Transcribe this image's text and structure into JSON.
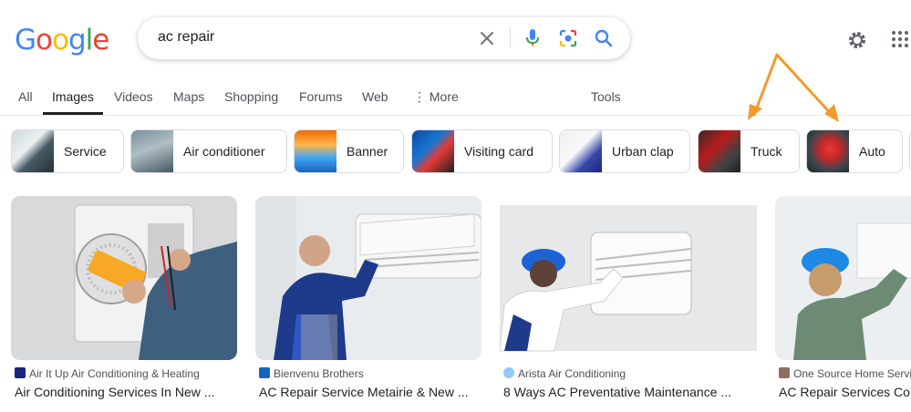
{
  "header": {
    "logo_text": "Google",
    "search": {
      "query": "ac repair"
    }
  },
  "tabs": [
    {
      "label": "All"
    },
    {
      "label": "Images",
      "active": true
    },
    {
      "label": "Videos"
    },
    {
      "label": "Maps"
    },
    {
      "label": "Shopping"
    },
    {
      "label": "Forums"
    },
    {
      "label": "Web"
    },
    {
      "label": "⋮ More"
    },
    {
      "label": "Tools"
    }
  ],
  "chips": [
    {
      "label": "Service"
    },
    {
      "label": "Air conditioner"
    },
    {
      "label": "Banner"
    },
    {
      "label": "Visiting card"
    },
    {
      "label": "Urban clap"
    },
    {
      "label": "Truck"
    },
    {
      "label": "Auto"
    }
  ],
  "results": [
    {
      "source": "Air It Up Air Conditioning & Heating",
      "title": "Air Conditioning Services In New ..."
    },
    {
      "source": "Bienvenu Brothers",
      "title": "AC Repair Service Metairie & New ..."
    },
    {
      "source": "Arista Air Conditioning",
      "title": "8 Ways AC Preventative Maintenance ..."
    },
    {
      "source": "One Source Home Servi",
      "title": "AC Repair Services Col"
    }
  ],
  "colors": {
    "annotation_arrow": "#f29a2e",
    "link_blue": "#1a73e8"
  },
  "icons": [
    "clear-icon",
    "mic-icon",
    "lens-icon",
    "search-icon",
    "gear-icon",
    "apps-icon"
  ]
}
